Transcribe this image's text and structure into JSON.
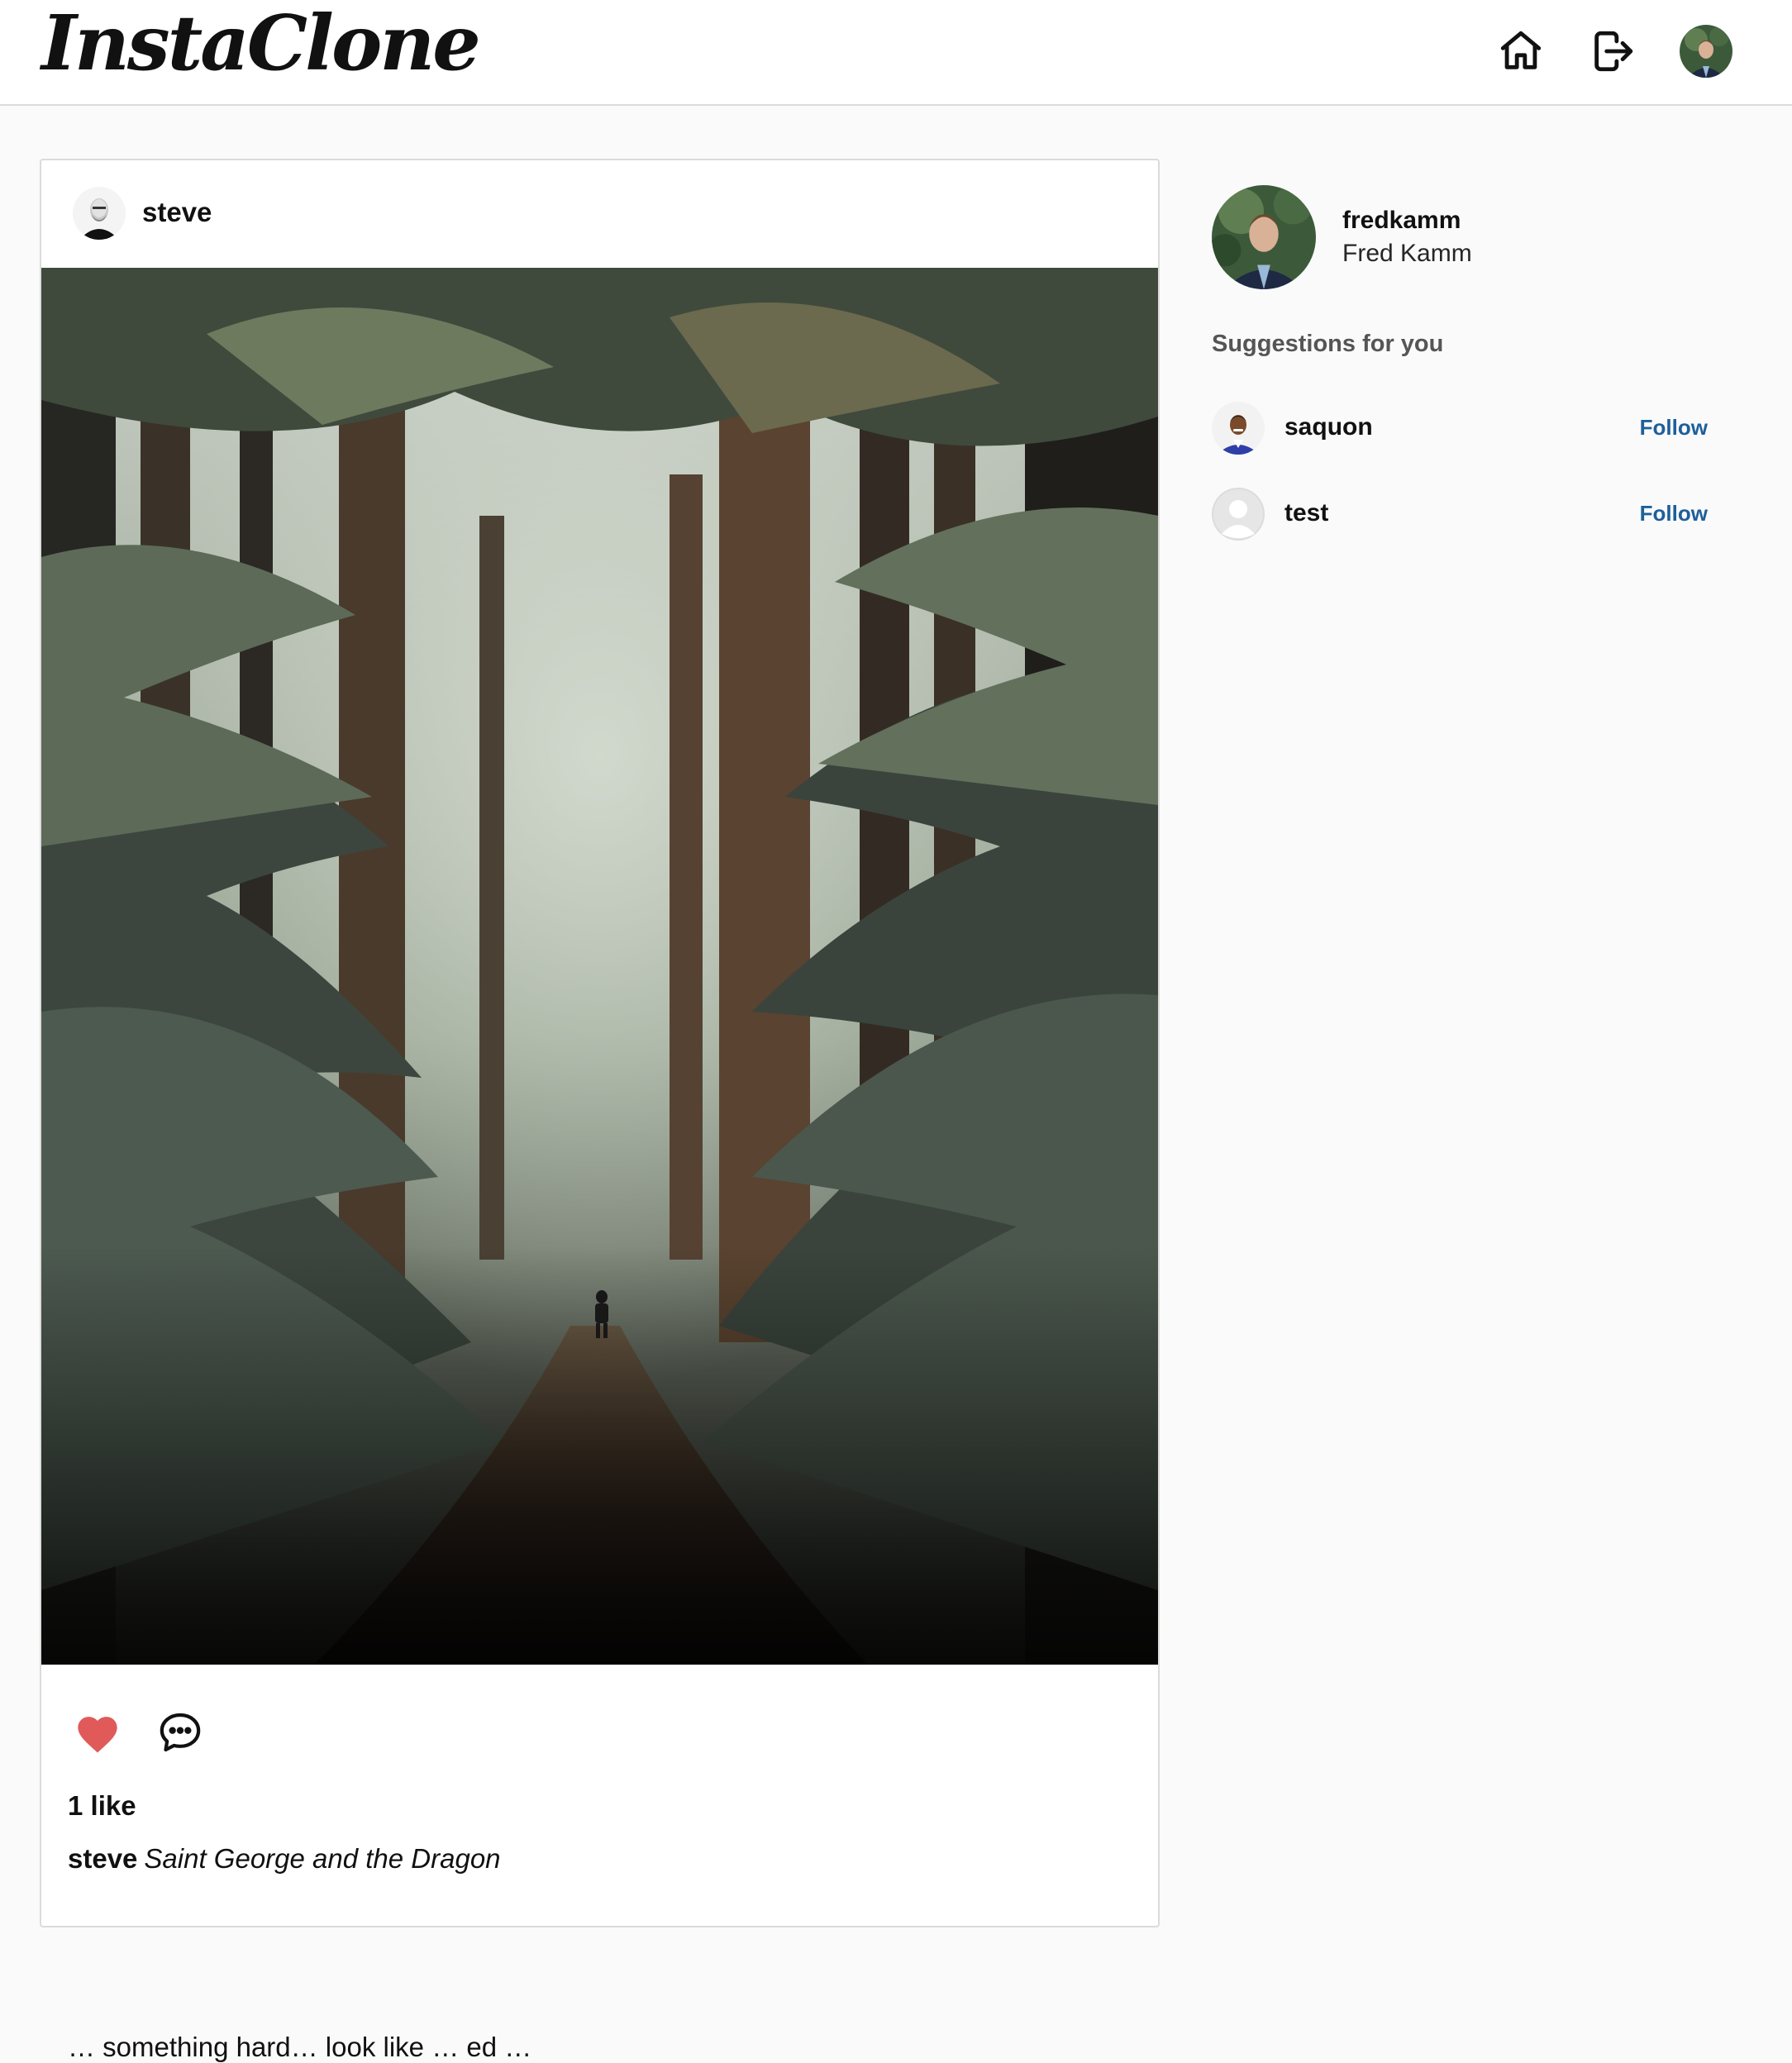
{
  "app": {
    "logo_text": "InstaClone"
  },
  "nav": {
    "home_icon": "home-icon",
    "logout_icon": "logout-icon"
  },
  "post": {
    "username": "steve",
    "likes": "1 like",
    "caption_user": "steve",
    "caption_text": "Saint George and the Dragon",
    "comment_preview": "… something hard…  look like … ed …"
  },
  "sidebar": {
    "username": "fredkamm",
    "full_name": "Fred Kamm",
    "suggestions_title": "Suggestions for you",
    "suggestions": [
      {
        "username": "saquon",
        "action": "Follow"
      },
      {
        "username": "test",
        "action": "Follow"
      }
    ]
  },
  "colors": {
    "like_active": "#e05a5a",
    "follow_link": "#1d5f9a",
    "border": "#dbdbdb",
    "background": "#fafafa"
  }
}
